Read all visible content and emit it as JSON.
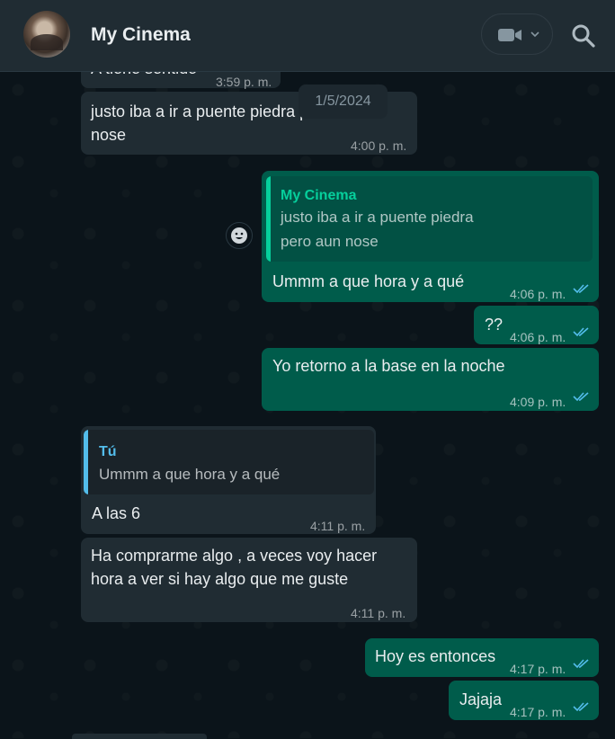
{
  "header": {
    "contact_name": "My Cinema",
    "avatar_icon": "contact-avatar",
    "video_icon": "video-call-icon",
    "dropdown_icon": "chevron-down-icon",
    "search_icon": "search-icon"
  },
  "date_chip": "1/5/2024",
  "colors": {
    "incoming_bubble": "#202c33",
    "outgoing_bubble": "#005c4b",
    "header": "#202c33",
    "quote_mine_accent": "#06cf9c",
    "quote_theirs_accent": "#53bdeb",
    "read_ticks": "#53bdeb"
  },
  "messages": [
    {
      "dir": "in",
      "text": "A tiene sentido",
      "time": "3:59 p. m."
    },
    {
      "dir": "in",
      "text_line1": "justo iba a ir a puente piedra pero aun",
      "text_line2": "nose",
      "time": "4:00 p. m."
    },
    {
      "dir": "out",
      "quote_author": "My Cinema",
      "quote_line1": "justo iba a ir a puente piedra",
      "quote_line2": "pero aun nose",
      "text": "Ummm a que hora y a qué",
      "time": "4:06 p. m."
    },
    {
      "dir": "out",
      "text": "??",
      "time": "4:06 p. m."
    },
    {
      "dir": "out",
      "text": "Yo retorno a la base en la noche",
      "time": "4:09 p. m."
    },
    {
      "dir": "in",
      "quote_author": "Tú",
      "quote_line1": "Ummm a que hora y a qué",
      "text": "A las 6",
      "time": "4:11 p. m."
    },
    {
      "dir": "in",
      "text_line1": "Ha comprarme algo , a veces voy hacer",
      "text_line2": "hora a ver si hay algo que me guste",
      "time": "4:11 p. m."
    },
    {
      "dir": "out",
      "text": "Hoy es entonces",
      "time": "4:17 p. m."
    },
    {
      "dir": "out",
      "text": "Jajaja",
      "time": "4:17 p. m."
    }
  ],
  "reaction_icon": "emoji-smiley-icon",
  "status_icon": "double-check-read-icon"
}
